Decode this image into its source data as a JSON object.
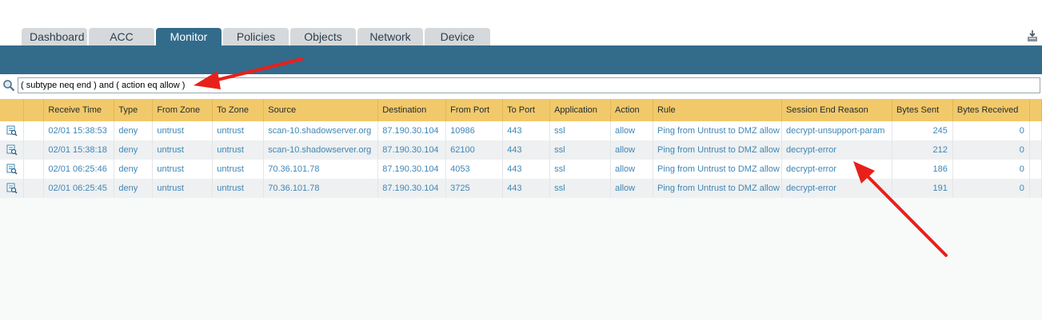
{
  "tabs": [
    {
      "label": "Dashboard",
      "active": false
    },
    {
      "label": "ACC",
      "active": false
    },
    {
      "label": "Monitor",
      "active": true
    },
    {
      "label": "Policies",
      "active": false
    },
    {
      "label": "Objects",
      "active": false
    },
    {
      "label": "Network",
      "active": false
    },
    {
      "label": "Device",
      "active": false
    }
  ],
  "filter": {
    "query": "( subtype neq end ) and ( action eq allow )"
  },
  "table": {
    "headers": [
      "Receive Time",
      "Type",
      "From Zone",
      "To Zone",
      "Source",
      "Destination",
      "From Port",
      "To Port",
      "Application",
      "Action",
      "Rule",
      "Session End Reason",
      "Bytes Sent",
      "Bytes Received"
    ],
    "rows": [
      [
        "02/01 15:38:53",
        "deny",
        "untrust",
        "untrust",
        "scan-10.shadowserver.org",
        "87.190.30.104",
        "10986",
        "443",
        "ssl",
        "allow",
        "Ping from Untrust to DMZ allow",
        "decrypt-unsupport-param",
        "245",
        "0"
      ],
      [
        "02/01 15:38:18",
        "deny",
        "untrust",
        "untrust",
        "scan-10.shadowserver.org",
        "87.190.30.104",
        "62100",
        "443",
        "ssl",
        "allow",
        "Ping from Untrust to DMZ allow",
        "decrypt-error",
        "212",
        "0"
      ],
      [
        "02/01 06:25:46",
        "deny",
        "untrust",
        "untrust",
        "70.36.101.78",
        "87.190.30.104",
        "4053",
        "443",
        "ssl",
        "allow",
        "Ping from Untrust to DMZ allow",
        "decrypt-error",
        "186",
        "0"
      ],
      [
        "02/01 06:25:45",
        "deny",
        "untrust",
        "untrust",
        "70.36.101.78",
        "87.190.30.104",
        "3725",
        "443",
        "ssl",
        "allow",
        "Ping from Untrust to DMZ allow",
        "decrypt-error",
        "191",
        "0"
      ]
    ]
  },
  "icons": {
    "search": "magnifier-icon",
    "export": "export-icon",
    "row_detail": "log-detail-icon"
  },
  "colors": {
    "tab_active": "#336b8b",
    "header_bar": "#336b8b",
    "table_header": "#f2c96a",
    "link_text": "#3f86b5",
    "annotation_arrow": "#e8201a"
  }
}
